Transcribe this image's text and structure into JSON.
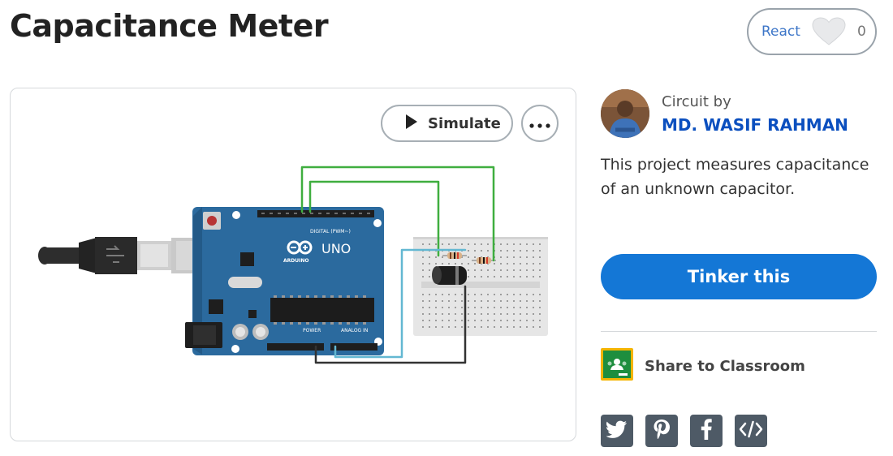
{
  "page": {
    "title": "Capacitance Meter"
  },
  "react": {
    "label": "React",
    "count": "0"
  },
  "preview": {
    "simulate_label": "Simulate",
    "board": {
      "logo_text": "UNO",
      "brand": "ARDUINO",
      "digital_label": "DIGITAL (PWM~)",
      "power_label": "POWER",
      "analog_label": "ANALOG IN"
    }
  },
  "author": {
    "label": "Circuit by",
    "name": "MD. WASIF RAHMAN"
  },
  "description": "This project measures capacitance of an unknown capacitor.",
  "tinker_label": "Tinker this",
  "share": {
    "classroom_label": "Share to Classroom"
  },
  "social": {
    "twitter": "twitter-icon",
    "pinterest": "pinterest-icon",
    "facebook": "facebook-icon",
    "embed": "embed-code-icon"
  },
  "colors": {
    "accent": "#1477d6",
    "author_link": "#0b4fbf",
    "board": "#2b6a9e",
    "wire_green": "#3fae3f",
    "wire_cyan": "#63b8d2",
    "wire_black": "#333333"
  }
}
